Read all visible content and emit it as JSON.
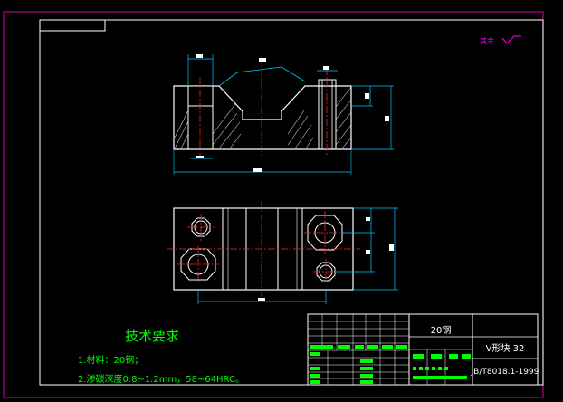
{
  "roughness_note": "其余",
  "tech_title": "技术要求",
  "tech_lines": [
    "1.材料：20钢；",
    "2.渗碳深度0.8~1.2mm，58~64HRC。"
  ],
  "title_block": {
    "material": "20钢",
    "part_name": "V形块 32",
    "drawing_no": "JB/T8018.1-1999"
  },
  "colors": {
    "background": "#000000",
    "frame": "#b2008f",
    "outline": "#ffffff",
    "dimension": "#00c8ff",
    "centerline": "#ff2020",
    "hatch": "#c8c8c8",
    "text_green": "#00ff00",
    "magenta": "#ff00ff"
  }
}
